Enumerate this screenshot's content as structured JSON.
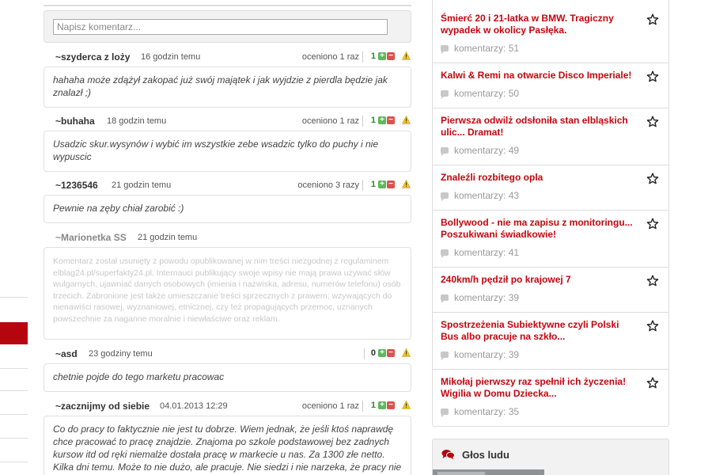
{
  "comment_form": {
    "placeholder": "Napisz komentarz..."
  },
  "comments": [
    {
      "author": "~szyderca z loży",
      "time": "16 godzin temu",
      "rated": "oceniono 1 raz",
      "score": "1",
      "text": "hahaha może zdążył zakopać już swój majątek i jak wyjdzie z pierdla będzie jak znalazł ;)"
    },
    {
      "author": "~buhaha",
      "time": "18 godzin temu",
      "rated": "oceniono 1 raz",
      "score": "1",
      "text": "Usadzic skur.wysynów i wybić im wszystkie zebe wsadzic tylko do puchy i nie wypuscic"
    },
    {
      "author": "~1236546",
      "time": "21 godzin temu",
      "rated": "oceniono 3 razy",
      "score": "1",
      "text": "Pewnie na zęby chiał zarobić :)"
    },
    {
      "author": "~Marionetka SS",
      "time": "21 godzin temu",
      "text": "Komentarz został usunięty z powodu opublikowanej w nim treści niezgodnej z regulaminem elblag24.pl/superfakty24.pl. Internauci publikujący swoje wpisy nie mają prawa używać słów wulgarnych, ujawniać danych osobowych (imienia i nazwiska, adresu, numerów telefonu) osób trzecich. Zabronione jest także umieszczanie treści sprzecznych z prawem; wzywających do nienawiści rasowej, wyznaniowej, etnicznej, czy też propagujących przemoc, uznanych powszechnie za naganne moralnie i niewłaściwe oraz reklam."
    },
    {
      "author": "~asd",
      "time": "23 godziny temu",
      "score": "0",
      "text": "chetnie pojde do tego marketu pracowac"
    },
    {
      "author": "~zacznijmy od siebie",
      "time": "04.01.2013 12:29",
      "rated": "oceniono 1 raz",
      "score": "1",
      "text": "Co do pracy to faktycznie nie jest tu dobrze. Wiem jednak, że jeśli ktoś naprawdę chce pracować to pracę znajdzie. Znajoma po szkole podstawowej bez zadnych kursow itd od ręki niemalże dostała pracę w markecie u nas. Za 1300 złe netto. Kilka dni temu. Może to nie dużo, ale pracuje. Nie siedzi i nie narzeka, że pracy nie ma. Dobrze by było, żeby dla wszystkich chcących pracy. Bo bezrobocie w..."
    }
  ],
  "vote_glyphs": {
    "up": "+",
    "down": "−"
  },
  "news": [
    {
      "title": "Śmierć 20 i 21-latka w BMW. Tragiczny wypadek w okolicy Pasłęka.",
      "comments": "komentarzy: 51"
    },
    {
      "title": "Kalwi & Remi na otwarcie Disco Imperiale!",
      "comments": "komentarzy: 50"
    },
    {
      "title": "Pierwsza odwilż odsłoniła stan elbląskich ulic... Dramat!",
      "comments": "komentarzy: 49"
    },
    {
      "title": "Znaleźli rozbitego opla",
      "comments": "komentarzy: 43"
    },
    {
      "title": "Bollywood - nie ma zapisu z monitoringu... Poszukiwani świadkowie!",
      "comments": "komentarzy: 41"
    },
    {
      "title": "240km/h pędził po krajowej 7",
      "comments": "komentarzy: 39"
    },
    {
      "title": "Spostrzeżenia Subiektywne czyli Polski Bus albo pracuje na szkło...",
      "comments": "komentarzy: 39"
    },
    {
      "title": "Mikołaj pierwszy raz spełnił ich życzenia! Wigilia w Domu Dziecka...",
      "comments": "komentarzy: 35"
    }
  ],
  "glos_ludu": {
    "label": "Głos ludu"
  },
  "colors": {
    "accent_red": "#c4050e",
    "up_green": "#5cb85c",
    "down_red": "#d9534f"
  }
}
